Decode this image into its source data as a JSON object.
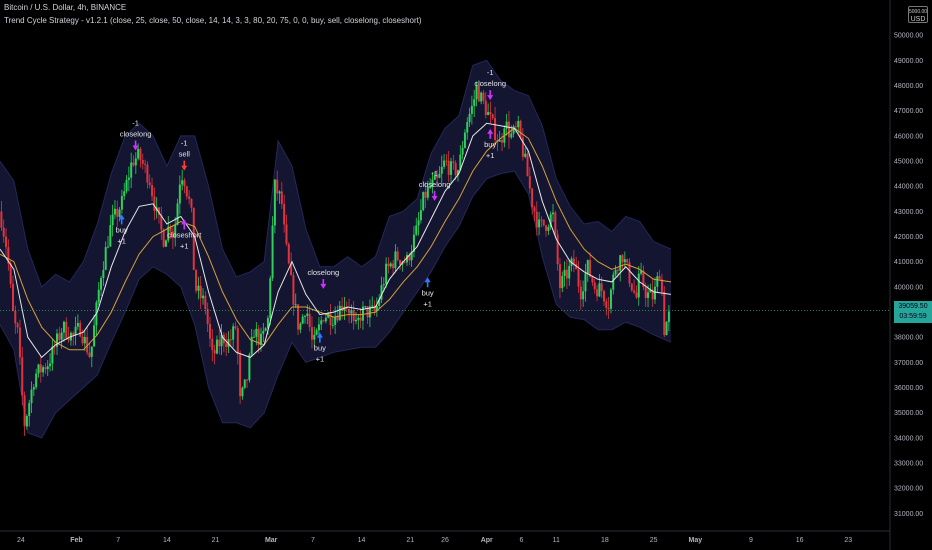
{
  "header": {
    "symbol_line": "Bitcoin / U.S. Dollar, 4h, BINANCE",
    "indicator_line": "Trend Cycle Strategy - v1.2.1 (close, 25, close, 50, close, 14, 14, 3, 3, 80, 20, 75, 0, 0, buy, sell, closelong, closeshort)"
  },
  "currency": {
    "top": "5000.00",
    "label": "USD"
  },
  "last_price": {
    "value": "39059.50",
    "countdown": "03:59:59",
    "color": "#26a69a"
  },
  "colors": {
    "up": "#2ed15a",
    "down": "#e0353f",
    "fast_ma": "#e8e8e8",
    "slow_ma": "#d9a034",
    "band_fill": "#16193a",
    "band_line": "#23285a",
    "signal": "#cc33ff",
    "buy_arrow": "#2d7cff",
    "sell_arrow": "#ff3b3b"
  },
  "chart_data": {
    "type": "candlestick",
    "symbol": "BTCUSD",
    "timeframe": "4h",
    "y_ticks": [
      31000,
      32000,
      33000,
      34000,
      35000,
      36000,
      37000,
      38000,
      39000,
      40000,
      41000,
      42000,
      43000,
      44000,
      45000,
      46000,
      47000,
      48000,
      49000,
      50000
    ],
    "y_tick_labels": [
      "31000.00",
      "32000.00",
      "33000.00",
      "34000.00",
      "35000.00",
      "36000.00",
      "37000.00",
      "38000.00",
      "39000.00",
      "40000.00",
      "41000.00",
      "42000.00",
      "43000.00",
      "44000.00",
      "45000.00",
      "46000.00",
      "47000.00",
      "48000.00",
      "49000.00",
      "50000.00"
    ],
    "ylim": [
      30300,
      51400
    ],
    "x_ticks": [
      {
        "label": "24",
        "day": -8,
        "bold": false
      },
      {
        "label": "Feb",
        "day": 0,
        "bold": true
      },
      {
        "label": "7",
        "day": 6,
        "bold": false
      },
      {
        "label": "14",
        "day": 13,
        "bold": false
      },
      {
        "label": "21",
        "day": 20,
        "bold": false
      },
      {
        "label": "Mar",
        "day": 28,
        "bold": true
      },
      {
        "label": "7",
        "day": 34,
        "bold": false
      },
      {
        "label": "14",
        "day": 41,
        "bold": false
      },
      {
        "label": "21",
        "day": 48,
        "bold": false
      },
      {
        "label": "26",
        "day": 53,
        "bold": false
      },
      {
        "label": "Apr",
        "day": 59,
        "bold": true
      },
      {
        "label": "6",
        "day": 64,
        "bold": false
      },
      {
        "label": "11",
        "day": 69,
        "bold": false
      },
      {
        "label": "18",
        "day": 76,
        "bold": false
      },
      {
        "label": "25",
        "day": 83,
        "bold": false
      },
      {
        "label": "May",
        "day": 89,
        "bold": true
      },
      {
        "label": "9",
        "day": 97,
        "bold": false
      },
      {
        "label": "16",
        "day": 104,
        "bold": false
      },
      {
        "label": "23",
        "day": 111,
        "bold": false
      }
    ],
    "xlim_days": [
      -11,
      117
    ],
    "price_path": [
      [
        -11,
        43000
      ],
      [
        -10,
        41500
      ],
      [
        -9,
        38500
      ],
      [
        -8.5,
        38300
      ],
      [
        -7.5,
        34500
      ],
      [
        -6,
        36500
      ],
      [
        -4,
        37000
      ],
      [
        -2,
        38400
      ],
      [
        -0.5,
        38000
      ],
      [
        0.5,
        38400
      ],
      [
        2,
        37200
      ],
      [
        3.5,
        40500
      ],
      [
        5,
        42500
      ],
      [
        6.5,
        43300
      ],
      [
        8,
        45000
      ],
      [
        9,
        45200
      ],
      [
        10.5,
        44300
      ],
      [
        11.5,
        42900
      ],
      [
        12.5,
        41900
      ],
      [
        13.5,
        42500
      ],
      [
        14,
        42000
      ],
      [
        15,
        44600
      ],
      [
        15.5,
        44300
      ],
      [
        16.5,
        43000
      ],
      [
        17,
        40000
      ],
      [
        18.5,
        39300
      ],
      [
        19.5,
        37200
      ],
      [
        21,
        38000
      ],
      [
        22,
        37800
      ],
      [
        23,
        38500
      ],
      [
        23.5,
        35400
      ],
      [
        24.5,
        36300
      ],
      [
        25.5,
        38300
      ],
      [
        26.5,
        37800
      ],
      [
        27.5,
        38500
      ],
      [
        28.5,
        44000
      ],
      [
        29.5,
        43400
      ],
      [
        30,
        41800
      ],
      [
        31,
        39900
      ],
      [
        32,
        38300
      ],
      [
        33,
        39300
      ],
      [
        34,
        37600
      ],
      [
        35.5,
        38900
      ],
      [
        37,
        38800
      ],
      [
        38.5,
        39400
      ],
      [
        39.5,
        39000
      ],
      [
        40,
        38200
      ],
      [
        41,
        39000
      ],
      [
        43,
        39000
      ],
      [
        44.5,
        40600
      ],
      [
        46,
        41200
      ],
      [
        47.5,
        41000
      ],
      [
        49,
        42300
      ],
      [
        50,
        43600
      ],
      [
        51,
        44000
      ],
      [
        52,
        44200
      ],
      [
        53,
        45000
      ],
      [
        54,
        44600
      ],
      [
        55,
        44700
      ],
      [
        56,
        46500
      ],
      [
        57,
        47200
      ],
      [
        57.5,
        47900
      ],
      [
        59,
        47000
      ],
      [
        60,
        46300
      ],
      [
        61,
        45600
      ],
      [
        61.5,
        46600
      ],
      [
        62.5,
        46000
      ],
      [
        63.5,
        46300
      ],
      [
        64.5,
        45000
      ],
      [
        65.5,
        43400
      ],
      [
        66.5,
        42400
      ],
      [
        67.5,
        42500
      ],
      [
        68.5,
        42900
      ],
      [
        69.5,
        40000
      ],
      [
        70.5,
        40500
      ],
      [
        71.5,
        41000
      ],
      [
        72.5,
        39800
      ],
      [
        73.5,
        40800
      ],
      [
        74.5,
        40000
      ],
      [
        75.5,
        39900
      ],
      [
        76.5,
        39300
      ],
      [
        77.5,
        40800
      ],
      [
        78.5,
        41300
      ],
      [
        79.5,
        40400
      ],
      [
        80.5,
        39500
      ],
      [
        81,
        40500
      ],
      [
        82,
        39700
      ],
      [
        83,
        39600
      ],
      [
        84,
        40800
      ],
      [
        84.5,
        38300
      ],
      [
        85.5,
        39059.5
      ]
    ],
    "fast_ma": [
      [
        -11,
        41500
      ],
      [
        -9,
        40700
      ],
      [
        -7,
        38000
      ],
      [
        -5,
        37200
      ],
      [
        -3,
        37700
      ],
      [
        -1,
        38000
      ],
      [
        1,
        38200
      ],
      [
        3,
        39000
      ],
      [
        5,
        40800
      ],
      [
        7,
        42200
      ],
      [
        9,
        43200
      ],
      [
        11,
        43300
      ],
      [
        13,
        42500
      ],
      [
        15,
        42800
      ],
      [
        17,
        42000
      ],
      [
        19,
        39800
      ],
      [
        21,
        38000
      ],
      [
        23,
        37400
      ],
      [
        25,
        37200
      ],
      [
        27,
        37700
      ],
      [
        29,
        39800
      ],
      [
        31,
        41000
      ],
      [
        33,
        39700
      ],
      [
        35,
        38900
      ],
      [
        37,
        39000
      ],
      [
        39,
        39200
      ],
      [
        41,
        39100
      ],
      [
        43,
        39200
      ],
      [
        45,
        40300
      ],
      [
        47,
        41000
      ],
      [
        49,
        41600
      ],
      [
        51,
        42700
      ],
      [
        53,
        43800
      ],
      [
        55,
        44500
      ],
      [
        57,
        46000
      ],
      [
        59,
        46500
      ],
      [
        61,
        46400
      ],
      [
        63,
        46300
      ],
      [
        65,
        45400
      ],
      [
        67,
        43400
      ],
      [
        69,
        41900
      ],
      [
        71,
        41000
      ],
      [
        73,
        40600
      ],
      [
        75,
        40300
      ],
      [
        77,
        40200
      ],
      [
        79,
        40800
      ],
      [
        81,
        40200
      ],
      [
        83,
        39800
      ],
      [
        85.5,
        39700
      ]
    ],
    "slow_ma": [
      [
        -11,
        41300
      ],
      [
        -9,
        41000
      ],
      [
        -7,
        39500
      ],
      [
        -5,
        38400
      ],
      [
        -3,
        37800
      ],
      [
        -1,
        37500
      ],
      [
        1,
        37500
      ],
      [
        3,
        38100
      ],
      [
        5,
        39000
      ],
      [
        7,
        40200
      ],
      [
        9,
        41300
      ],
      [
        11,
        42000
      ],
      [
        13,
        42300
      ],
      [
        15,
        42600
      ],
      [
        17,
        42400
      ],
      [
        19,
        41200
      ],
      [
        21,
        39800
      ],
      [
        23,
        38700
      ],
      [
        25,
        37900
      ],
      [
        27,
        37700
      ],
      [
        29,
        38500
      ],
      [
        31,
        39200
      ],
      [
        33,
        39200
      ],
      [
        35,
        39000
      ],
      [
        37,
        38800
      ],
      [
        39,
        38900
      ],
      [
        41,
        38900
      ],
      [
        43,
        39000
      ],
      [
        45,
        39500
      ],
      [
        47,
        40200
      ],
      [
        49,
        40800
      ],
      [
        51,
        41600
      ],
      [
        53,
        42600
      ],
      [
        55,
        43500
      ],
      [
        57,
        44600
      ],
      [
        59,
        45400
      ],
      [
        61,
        45900
      ],
      [
        63,
        46300
      ],
      [
        65,
        45900
      ],
      [
        67,
        44800
      ],
      [
        69,
        43400
      ],
      [
        71,
        42300
      ],
      [
        73,
        41500
      ],
      [
        75,
        41000
      ],
      [
        77,
        40700
      ],
      [
        79,
        40900
      ],
      [
        81,
        40700
      ],
      [
        83,
        40300
      ],
      [
        85.5,
        40200
      ]
    ],
    "band_upper": [
      [
        -11,
        45000
      ],
      [
        -9,
        44200
      ],
      [
        -7,
        41500
      ],
      [
        -5,
        40000
      ],
      [
        -3,
        40500
      ],
      [
        -1,
        40200
      ],
      [
        1,
        41000
      ],
      [
        3,
        42500
      ],
      [
        5,
        44500
      ],
      [
        7,
        46000
      ],
      [
        9,
        46500
      ],
      [
        11,
        46000
      ],
      [
        13,
        44800
      ],
      [
        15,
        46000
      ],
      [
        17,
        46000
      ],
      [
        19,
        44000
      ],
      [
        21,
        41500
      ],
      [
        23,
        40400
      ],
      [
        25,
        40600
      ],
      [
        27,
        41000
      ],
      [
        29,
        45800
      ],
      [
        31,
        44800
      ],
      [
        33,
        42300
      ],
      [
        35,
        40800
      ],
      [
        37,
        40800
      ],
      [
        39,
        41200
      ],
      [
        41,
        40800
      ],
      [
        43,
        41200
      ],
      [
        45,
        42800
      ],
      [
        47,
        43000
      ],
      [
        49,
        43500
      ],
      [
        51,
        45300
      ],
      [
        53,
        46300
      ],
      [
        55,
        46800
      ],
      [
        57,
        48800
      ],
      [
        59,
        49000
      ],
      [
        61,
        48200
      ],
      [
        63,
        47800
      ],
      [
        65,
        47600
      ],
      [
        67,
        46400
      ],
      [
        69,
        44300
      ],
      [
        71,
        43200
      ],
      [
        73,
        42500
      ],
      [
        75,
        42600
      ],
      [
        77,
        42200
      ],
      [
        79,
        42800
      ],
      [
        81,
        42600
      ],
      [
        83,
        41800
      ],
      [
        85.5,
        41500
      ]
    ],
    "band_lower": [
      [
        -11,
        38500
      ],
      [
        -9,
        37500
      ],
      [
        -7,
        34200
      ],
      [
        -5,
        34000
      ],
      [
        -3,
        35000
      ],
      [
        -1,
        35500
      ],
      [
        1,
        36000
      ],
      [
        3,
        36500
      ],
      [
        5,
        37800
      ],
      [
        7,
        39000
      ],
      [
        9,
        40300
      ],
      [
        11,
        40800
      ],
      [
        13,
        40500
      ],
      [
        15,
        40000
      ],
      [
        17,
        38500
      ],
      [
        19,
        36000
      ],
      [
        21,
        34600
      ],
      [
        23,
        34600
      ],
      [
        25,
        34400
      ],
      [
        27,
        35000
      ],
      [
        29,
        36500
      ],
      [
        31,
        37800
      ],
      [
        33,
        37000
      ],
      [
        35,
        37200
      ],
      [
        37,
        37400
      ],
      [
        39,
        37500
      ],
      [
        41,
        37600
      ],
      [
        43,
        37600
      ],
      [
        45,
        38200
      ],
      [
        47,
        39000
      ],
      [
        49,
        39800
      ],
      [
        51,
        40600
      ],
      [
        53,
        41600
      ],
      [
        55,
        42400
      ],
      [
        57,
        43600
      ],
      [
        59,
        44300
      ],
      [
        61,
        44500
      ],
      [
        63,
        44600
      ],
      [
        65,
        43700
      ],
      [
        67,
        41200
      ],
      [
        69,
        39300
      ],
      [
        71,
        38800
      ],
      [
        73,
        38700
      ],
      [
        75,
        38300
      ],
      [
        77,
        38300
      ],
      [
        79,
        38600
      ],
      [
        81,
        38400
      ],
      [
        83,
        38100
      ],
      [
        85.5,
        37800
      ]
    ],
    "signals": [
      {
        "day": 8.5,
        "price": 45300,
        "position": "above",
        "arrow": "close",
        "lines": [
          "-1",
          "closelong"
        ]
      },
      {
        "day": 15.5,
        "price": 44500,
        "position": "above",
        "arrow": "sell",
        "lines": [
          "-1",
          "sell"
        ]
      },
      {
        "day": 6.5,
        "price": 43000,
        "position": "below",
        "arrow": "buy",
        "lines": [
          "buy",
          "+1"
        ]
      },
      {
        "day": 15.5,
        "price": 42800,
        "position": "below",
        "arrow": "close",
        "lines": [
          "closeshort",
          "+1"
        ]
      },
      {
        "day": 35.5,
        "price": 39800,
        "position": "above",
        "arrow": "close",
        "lines": [
          "closelong"
        ]
      },
      {
        "day": 35,
        "price": 38300,
        "position": "below",
        "arrow": "buy",
        "lines": [
          "buy",
          "+1"
        ]
      },
      {
        "day": 51.5,
        "price": 43300,
        "position": "above",
        "arrow": "close",
        "lines": [
          "-1",
          "closelong"
        ]
      },
      {
        "day": 50.5,
        "price": 40500,
        "position": "below",
        "arrow": "buy",
        "lines": [
          "buy",
          "+1"
        ]
      },
      {
        "day": 59.5,
        "price": 47300,
        "position": "above",
        "arrow": "close",
        "lines": [
          "-1",
          "closelong"
        ]
      },
      {
        "day": 59.5,
        "price": 46400,
        "position": "below",
        "arrow": "close",
        "lines": [
          "buy",
          "+1"
        ]
      }
    ]
  }
}
